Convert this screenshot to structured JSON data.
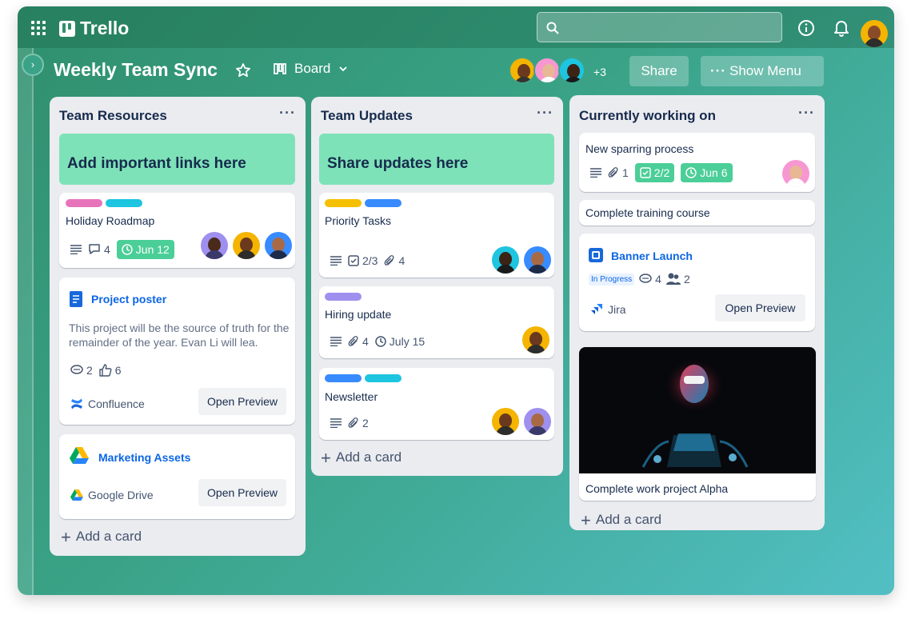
{
  "app": {
    "name": "Trello"
  },
  "board": {
    "title": "Weekly Team Sync",
    "view": "Board",
    "extra_members": "+3",
    "share_label": "Share",
    "menu_label": "Show Menu"
  },
  "lists": [
    {
      "title": "Team Resources",
      "banner": "Add important links here",
      "cards": [
        {
          "title": "Holiday Roadmap",
          "labels": [
            "#e774bb",
            "#1ec5e0"
          ],
          "comments": "4",
          "due": "Jun 12"
        },
        {
          "title": "Project poster",
          "description": "This project will be the source of truth for the remainder of the year. Evan Li will lea.",
          "comments": "2",
          "likes": "6",
          "source": "Confluence",
          "action": "Open Preview"
        },
        {
          "title": "Marketing Assets",
          "source": "Google Drive",
          "action": "Open Preview"
        }
      ],
      "add_card": "Add a card"
    },
    {
      "title": "Team Updates",
      "banner": "Share updates here",
      "cards": [
        {
          "title": "Priority Tasks",
          "labels": [
            "#f5c000",
            "#388bff"
          ],
          "checklist": "2/3",
          "attachments": "4"
        },
        {
          "title": "Hiring update",
          "labels": [
            "#9f8fef"
          ],
          "attachments": "4",
          "due": "July 15"
        },
        {
          "title": "Newsletter",
          "labels": [
            "#388bff",
            "#1ec5e0"
          ],
          "attachments": "2"
        }
      ],
      "add_card": "Add a card"
    },
    {
      "title": "Currently working on",
      "cards": [
        {
          "title": "New sparring process",
          "attachments": "1",
          "checklist": "2/2",
          "due": "Jun 6"
        },
        {
          "title": "Complete training course"
        },
        {
          "title": "Banner Launch",
          "status": "In Progress",
          "comments": "4",
          "members": "2",
          "source": "Jira",
          "action": "Open Preview"
        },
        {
          "title": "Complete work project Alpha"
        }
      ],
      "add_card": "Add a card"
    }
  ],
  "colors": {
    "accent_green": "#4bce97",
    "banner_green": "#7ee2b8",
    "link_blue": "#0c66e4"
  },
  "icons": [
    "apps-grid-icon",
    "trello-logo-icon",
    "search-icon",
    "info-icon",
    "bell-icon",
    "star-icon",
    "board-view-icon",
    "chevron-down-icon",
    "more-icon",
    "description-icon",
    "comment-icon",
    "clock-icon",
    "checklist-icon",
    "attachment-icon",
    "like-icon",
    "members-icon",
    "plus-icon",
    "confluence-icon",
    "google-drive-icon",
    "jira-icon",
    "document-icon"
  ]
}
